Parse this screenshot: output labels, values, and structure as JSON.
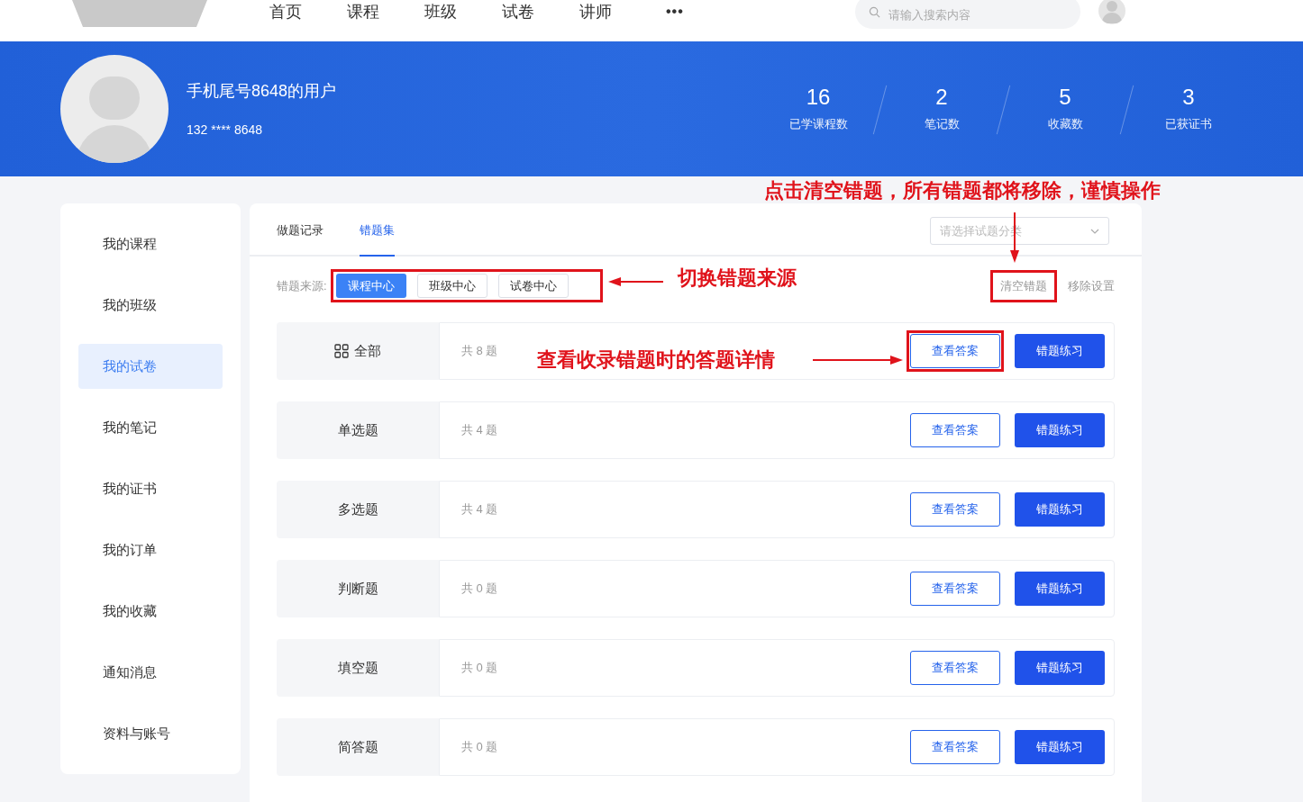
{
  "nav": {
    "items": [
      "首页",
      "课程",
      "班级",
      "试卷",
      "讲师"
    ],
    "more": "•••",
    "search_placeholder": "请输入搜索内容"
  },
  "profile": {
    "name": "手机尾号8648的用户",
    "phone": "132 **** 8648",
    "stats": [
      {
        "value": "16",
        "label": "已学课程数"
      },
      {
        "value": "2",
        "label": "笔记数"
      },
      {
        "value": "5",
        "label": "收藏数"
      },
      {
        "value": "3",
        "label": "已获证书"
      }
    ]
  },
  "sidebar": {
    "items": [
      {
        "label": "我的课程",
        "selected": false
      },
      {
        "label": "我的班级",
        "selected": false
      },
      {
        "label": "我的试卷",
        "selected": true
      },
      {
        "label": "我的笔记",
        "selected": false
      },
      {
        "label": "我的证书",
        "selected": false
      },
      {
        "label": "我的订单",
        "selected": false
      },
      {
        "label": "我的收藏",
        "selected": false
      },
      {
        "label": "通知消息",
        "selected": false
      },
      {
        "label": "资料与账号",
        "selected": false
      }
    ]
  },
  "tabs": [
    {
      "label": "做题记录",
      "selected": false
    },
    {
      "label": "错题集",
      "selected": true
    }
  ],
  "category_select": {
    "placeholder": "请选择试题分类"
  },
  "source": {
    "label": "错题来源:",
    "options": [
      {
        "label": "课程中心",
        "selected": true
      },
      {
        "label": "班级中心",
        "selected": false
      },
      {
        "label": "试卷中心",
        "selected": false
      }
    ]
  },
  "actions": {
    "clear": "清空错题",
    "remove_settings": "移除设置"
  },
  "rows": [
    {
      "kind": "all",
      "label": "全部",
      "count": "共 8 题",
      "view": "查看答案",
      "practice": "错题练习"
    },
    {
      "kind": "type",
      "label": "单选题",
      "count": "共 4 题",
      "view": "查看答案",
      "practice": "错题练习"
    },
    {
      "kind": "type",
      "label": "多选题",
      "count": "共 4 题",
      "view": "查看答案",
      "practice": "错题练习"
    },
    {
      "kind": "type",
      "label": "判断题",
      "count": "共 0 题",
      "view": "查看答案",
      "practice": "错题练习"
    },
    {
      "kind": "type",
      "label": "填空题",
      "count": "共 0 题",
      "view": "查看答案",
      "practice": "错题练习"
    },
    {
      "kind": "type",
      "label": "简答题",
      "count": "共 0 题",
      "view": "查看答案",
      "practice": "错题练习"
    }
  ],
  "annotations": {
    "clear": "点击清空错题，所有错题都将移除，谨慎操作",
    "source": "切换错题来源",
    "answer": "查看收录错题时的答题详情"
  }
}
